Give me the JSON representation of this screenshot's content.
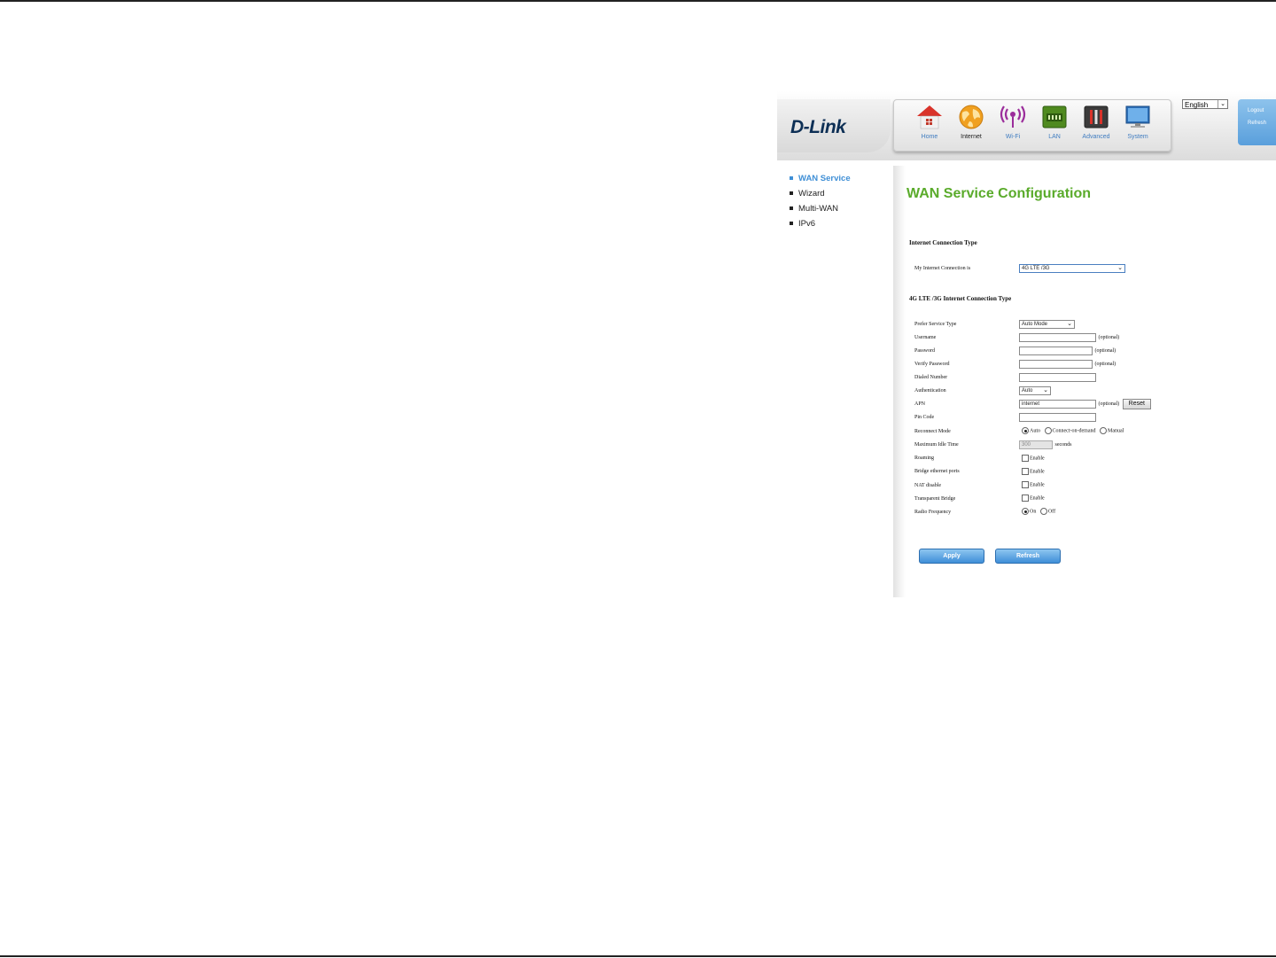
{
  "logo": {
    "text": "D-Link"
  },
  "nav": [
    {
      "label": "Home",
      "icon": "home-icon",
      "active": false
    },
    {
      "label": "Internet",
      "icon": "globe-icon",
      "active": true
    },
    {
      "label": "Wi-Fi",
      "icon": "wifi-icon",
      "active": false
    },
    {
      "label": "LAN",
      "icon": "lan-icon",
      "active": false
    },
    {
      "label": "Advanced",
      "icon": "advanced-icon",
      "active": false
    },
    {
      "label": "System",
      "icon": "monitor-icon",
      "active": false
    }
  ],
  "language": {
    "selected": "English"
  },
  "user_menu": {
    "logout": "Logout",
    "refresh": "Refresh"
  },
  "sidebar": {
    "items": [
      {
        "label": "WAN Service",
        "active": true
      },
      {
        "label": "Wizard",
        "active": false
      },
      {
        "label": "Multi-WAN",
        "active": false
      },
      {
        "label": "IPv6",
        "active": false
      }
    ]
  },
  "page": {
    "title": "WAN Service Configuration",
    "section1_title": "Internet Connection Type",
    "connection_label": "My Internet Connection is",
    "connection_value": "4G LTE /3G",
    "section2_title": "4G LTE /3G Internet Connection Type"
  },
  "form": {
    "prefer_service_type": {
      "label": "Prefer Service Type",
      "value": "Auto Mode"
    },
    "username": {
      "label": "Username",
      "value": "",
      "hint": "(optional)"
    },
    "password": {
      "label": "Password",
      "value": "",
      "hint": "(optional)"
    },
    "verify_password": {
      "label": "Verify Password",
      "value": "",
      "hint": "(optional)"
    },
    "dialed_number": {
      "label": "Dialed Number",
      "value": ""
    },
    "authentication": {
      "label": "Authentication",
      "value": "Auto"
    },
    "apn": {
      "label": "APN",
      "value": "internet",
      "hint": "(optional)",
      "reset": "Reset"
    },
    "pin_code": {
      "label": "Pin Code",
      "value": ""
    },
    "reconnect_mode": {
      "label": "Reconnect Mode",
      "options": [
        "Auto",
        "Connect-on-demand",
        "Manual"
      ],
      "selected": "Auto"
    },
    "max_idle_time": {
      "label": "Maximum Idle Time",
      "value": "300",
      "unit": "seconds"
    },
    "roaming": {
      "label": "Roaming",
      "option": "Enable",
      "checked": false
    },
    "bridge_ethernet_ports": {
      "label": "Bridge ethernet ports",
      "option": "Enable",
      "checked": false
    },
    "nat_disable": {
      "label": "NAT disable",
      "option": "Enable",
      "checked": false
    },
    "transparent_bridge": {
      "label": "Transparent Bridge",
      "option": "Enable",
      "checked": false
    },
    "radio_frequency": {
      "label": "Radio Frequency",
      "options": [
        "On",
        "Off"
      ],
      "selected": "On"
    }
  },
  "buttons": {
    "apply": "Apply",
    "refresh": "Refresh"
  },
  "colors": {
    "accent_blue": "#3f8fd6",
    "title_green": "#5aab2b",
    "logo_navy": "#0d2f55"
  }
}
